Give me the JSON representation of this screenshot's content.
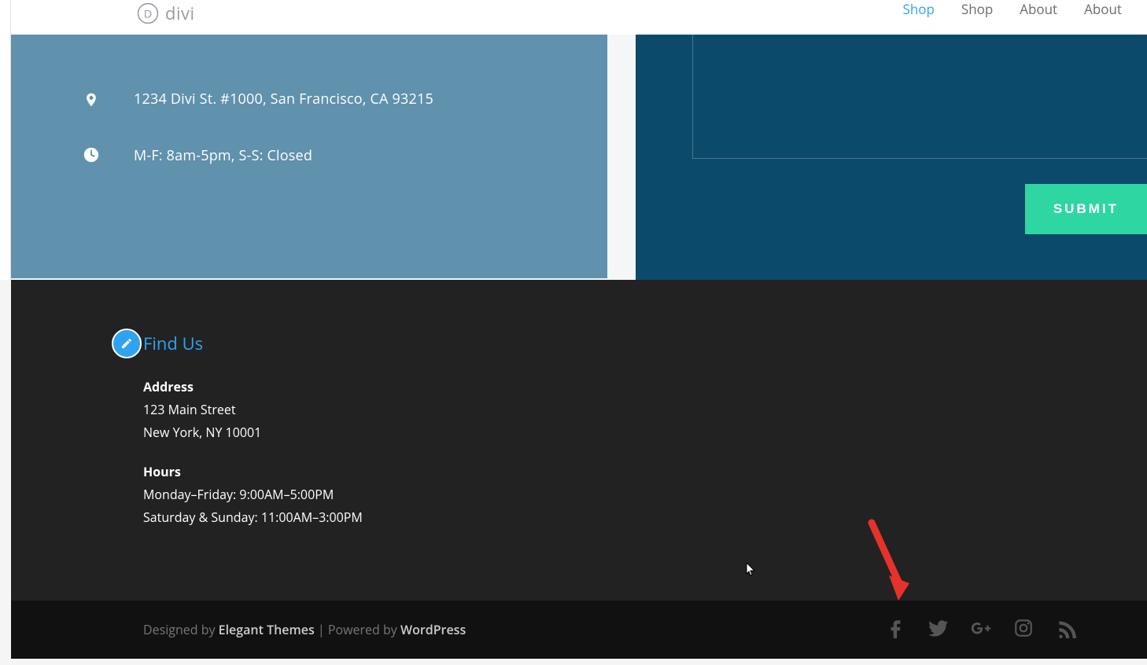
{
  "header": {
    "logo_text": "divi",
    "nav": [
      {
        "label": "Shop",
        "active": true
      },
      {
        "label": "Shop",
        "active": false
      },
      {
        "label": "About",
        "active": false
      },
      {
        "label": "About",
        "active": false
      }
    ]
  },
  "contact_card": {
    "address": "1234 Divi St. #1000, San Francisco, CA 93215",
    "hours": "M-F: 8am-5pm, S-S: Closed"
  },
  "form": {
    "submit_label": "SUBMIT"
  },
  "footer_widget": {
    "title": "Find Us",
    "address_label": "Address",
    "address_line1": "123 Main Street",
    "address_line2": "New York, NY 10001",
    "hours_label": "Hours",
    "hours_line1": "Monday–Friday: 9:00AM–5:00PM",
    "hours_line2": "Saturday & Sunday: 11:00AM–3:00PM"
  },
  "bottom_bar": {
    "designed_prefix": "Designed by ",
    "designed_by": "Elegant Themes",
    "separator": " | ",
    "powered_prefix": "Powered by ",
    "powered_by": "WordPress"
  }
}
